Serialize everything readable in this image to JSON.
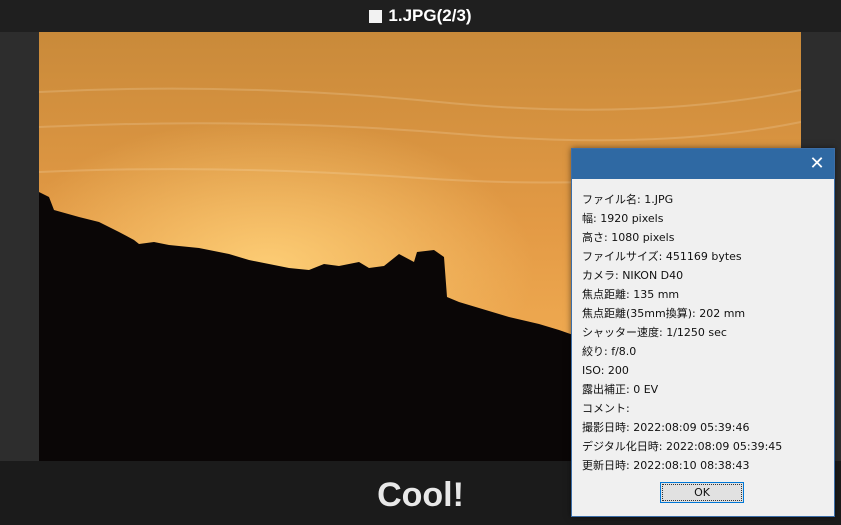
{
  "window": {
    "title": "1.JPG(2/3)",
    "title_icon": "square-icon"
  },
  "photo": {
    "subject": "sunset-mountain-silhouette",
    "sky_colors": [
      "#c98a3a",
      "#e9a24a",
      "#f7b85a"
    ]
  },
  "caption": "Cool!",
  "dialog": {
    "close_icon": "close-icon",
    "info": [
      "ファイル名: 1.JPG",
      "幅: 1920 pixels",
      "高さ: 1080 pixels",
      "ファイルサイズ: 451169 bytes",
      "カメラ: NIKON D40",
      "焦点距離: 135 mm",
      "焦点距離(35mm換算): 202 mm",
      "シャッター速度: 1/1250 sec",
      "絞り: f/8.0",
      "ISO: 200",
      "露出補正: 0 EV",
      "コメント:",
      "撮影日時: 2022:08:09 05:39:46",
      "デジタル化日時: 2022:08:09 05:39:45",
      "更新日時: 2022:08:10 08:38:43"
    ],
    "ok_label": "OK"
  },
  "colors": {
    "dialog_titlebar": "#2f69a3",
    "titlebar_bg": "#1f1f1f",
    "caption_bg": "#1b1b1b"
  }
}
